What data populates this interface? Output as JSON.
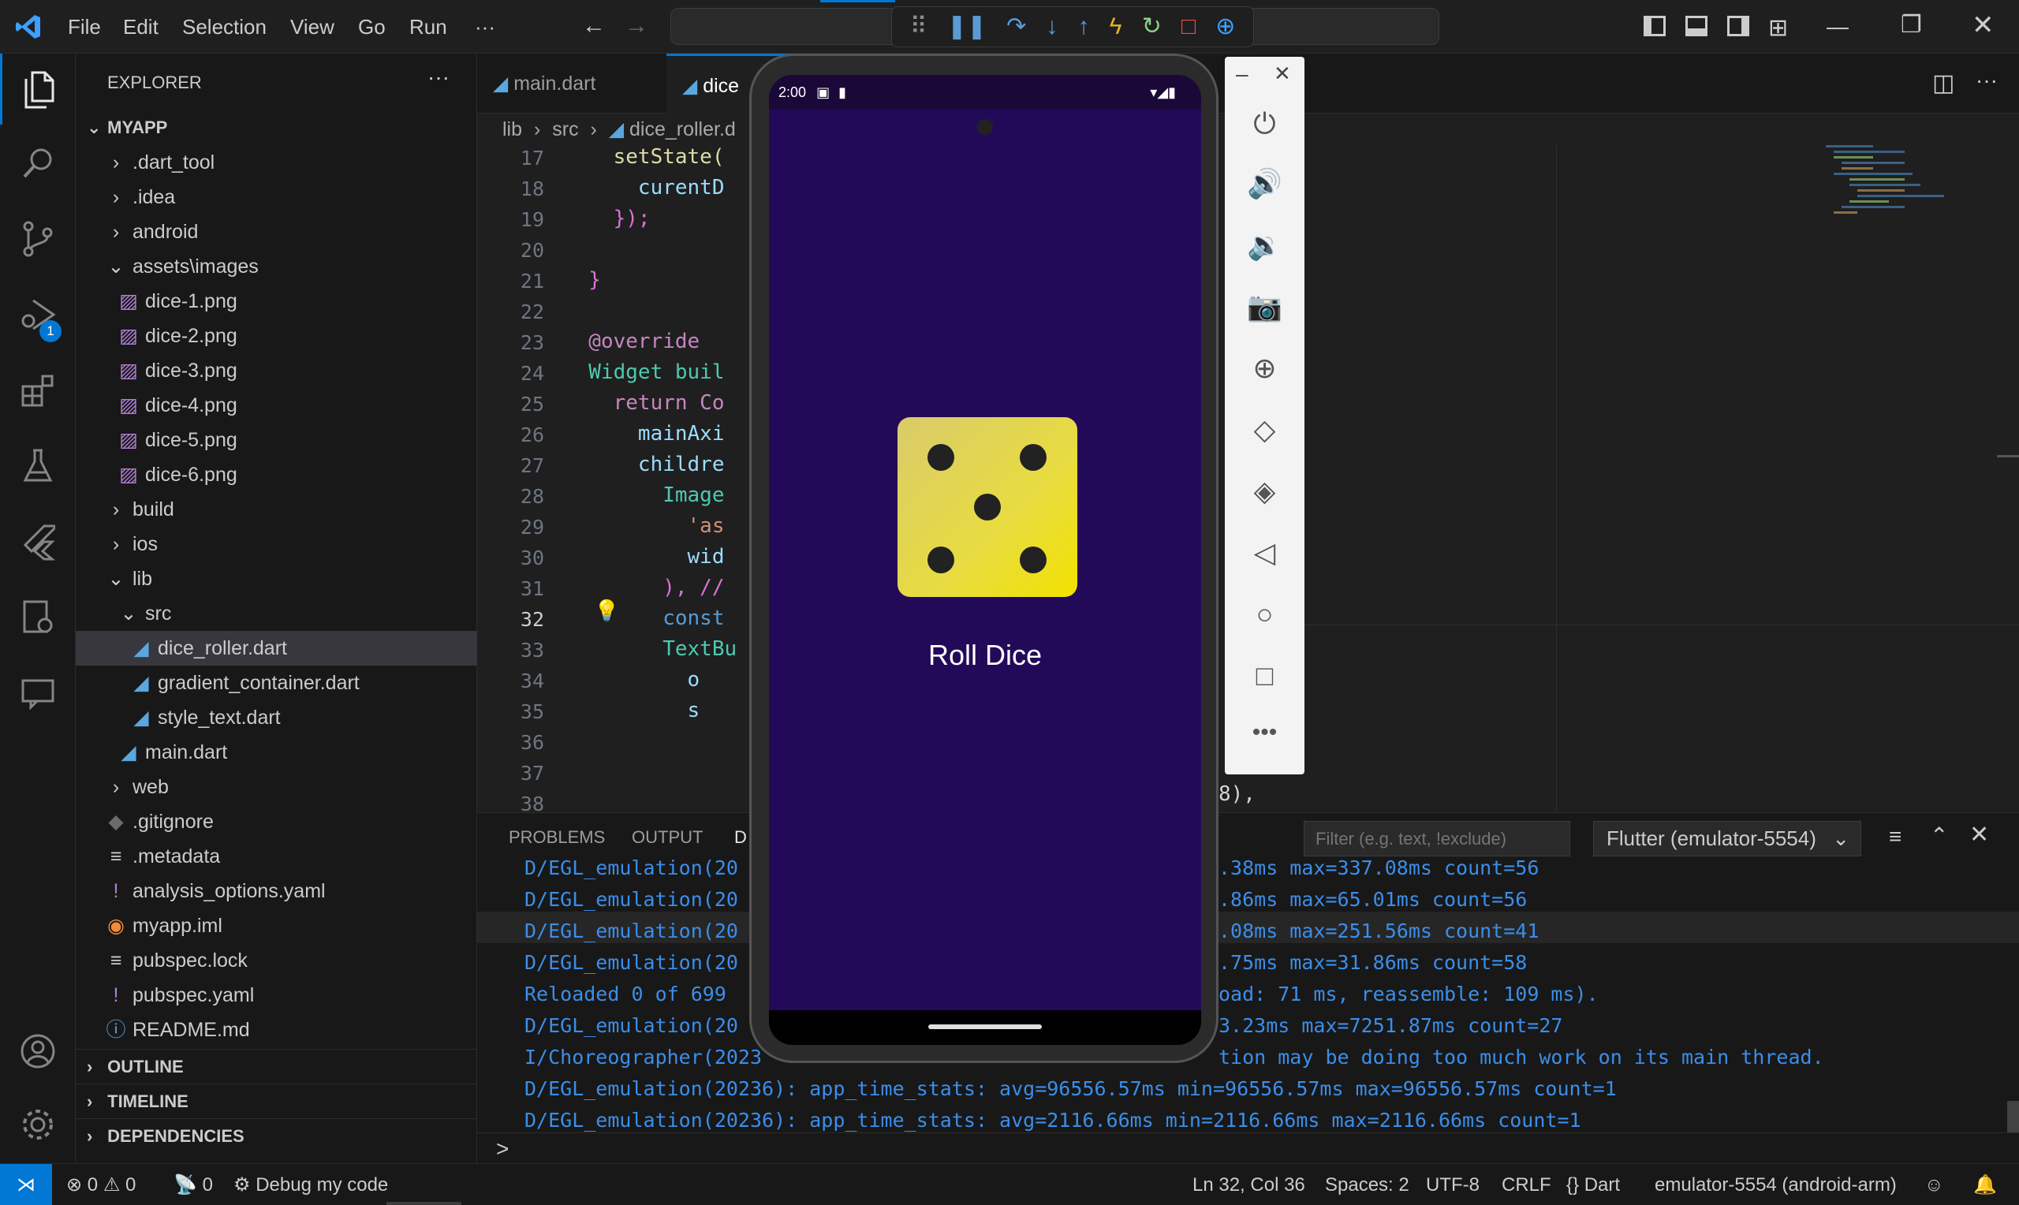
{
  "menu": {
    "file": "File",
    "edit": "Edit",
    "selection": "Selection",
    "view": "View",
    "go": "Go",
    "run": "Run",
    "more": "···"
  },
  "explorer": {
    "title": "EXPLORER",
    "more": "···",
    "root": "MYAPP",
    "tree": [
      {
        "label": ".dart_tool",
        "kind": "folder-closed",
        "indent": 0
      },
      {
        "label": ".idea",
        "kind": "folder-closed",
        "indent": 0
      },
      {
        "label": "android",
        "kind": "folder-closed",
        "indent": 0
      },
      {
        "label": "assets\\images",
        "kind": "folder-open",
        "indent": 0
      },
      {
        "label": "dice-1.png",
        "kind": "image",
        "indent": 1
      },
      {
        "label": "dice-2.png",
        "kind": "image",
        "indent": 1
      },
      {
        "label": "dice-3.png",
        "kind": "image",
        "indent": 1
      },
      {
        "label": "dice-4.png",
        "kind": "image",
        "indent": 1
      },
      {
        "label": "dice-5.png",
        "kind": "image",
        "indent": 1
      },
      {
        "label": "dice-6.png",
        "kind": "image",
        "indent": 1
      },
      {
        "label": "build",
        "kind": "folder-closed",
        "indent": 0
      },
      {
        "label": "ios",
        "kind": "folder-closed",
        "indent": 0
      },
      {
        "label": "lib",
        "kind": "folder-open",
        "indent": 0
      },
      {
        "label": "src",
        "kind": "folder-open",
        "indent": 1
      },
      {
        "label": "dice_roller.dart",
        "kind": "dart",
        "indent": 2,
        "selected": true
      },
      {
        "label": "gradient_container.dart",
        "kind": "dart",
        "indent": 2
      },
      {
        "label": "style_text.dart",
        "kind": "dart",
        "indent": 2
      },
      {
        "label": "main.dart",
        "kind": "dart",
        "indent": 1
      },
      {
        "label": "web",
        "kind": "folder-closed",
        "indent": 0
      },
      {
        "label": ".gitignore",
        "kind": "git",
        "indent": 0
      },
      {
        "label": ".metadata",
        "kind": "lines",
        "indent": 0
      },
      {
        "label": "analysis_options.yaml",
        "kind": "yaml",
        "indent": 0
      },
      {
        "label": "myapp.iml",
        "kind": "rss",
        "indent": 0
      },
      {
        "label": "pubspec.lock",
        "kind": "lines",
        "indent": 0
      },
      {
        "label": "pubspec.yaml",
        "kind": "yaml",
        "indent": 0
      },
      {
        "label": "README.md",
        "kind": "info",
        "indent": 0
      }
    ],
    "outline": "OUTLINE",
    "timeline": "TIMELINE",
    "dependencies": "DEPENDENCIES"
  },
  "tabs": [
    {
      "label": "main.dart"
    },
    {
      "label": "dice"
    }
  ],
  "breadcrumb": {
    "lib": "lib",
    "src": "src",
    "file": "dice_roller.d"
  },
  "editor": {
    "lines": [
      {
        "n": "17",
        "code": "    setState("
      },
      {
        "n": "18",
        "code": "      curentD"
      },
      {
        "n": "19",
        "code": "    });"
      },
      {
        "n": "20",
        "code": ""
      },
      {
        "n": "21",
        "code": "  }"
      },
      {
        "n": "22",
        "code": ""
      },
      {
        "n": "23",
        "code": "  @override"
      },
      {
        "n": "24",
        "code": "  Widget buil"
      },
      {
        "n": "25",
        "code": "    return Co"
      },
      {
        "n": "26",
        "code": "      mainAxi"
      },
      {
        "n": "27",
        "code": "      childre"
      },
      {
        "n": "28",
        "code": "        Image"
      },
      {
        "n": "29",
        "code": "          'as"
      },
      {
        "n": "30",
        "code": "          wid"
      },
      {
        "n": "31",
        "code": "        ), //"
      },
      {
        "n": "32",
        "code": "        const"
      },
      {
        "n": "33",
        "code": "        TextBu"
      },
      {
        "n": "34",
        "code": "          o"
      },
      {
        "n": "35",
        "code": "          s"
      },
      {
        "n": "36",
        "code": ""
      },
      {
        "n": "37",
        "code": ""
      },
      {
        "n": "38",
        "code": ""
      }
    ],
    "tail38": "8),"
  },
  "panel": {
    "problems": "PROBLEMS",
    "output": "OUTPUT",
    "debug": "D",
    "filter_placeholder": "Filter (e.g. text, !exclude)",
    "channel": "Flutter (emulator-5554)",
    "log": [
      {
        "left": "D/EGL_emulation(20",
        "right": ".38ms max=337.08ms count=56",
        "color": "#3b8eea"
      },
      {
        "left": "D/EGL_emulation(20",
        "right": ".86ms max=65.01ms count=56",
        "color": "#3b8eea"
      },
      {
        "left": "D/EGL_emulation(20",
        "right": ".08ms max=251.56ms count=41",
        "color": "#3b8eea"
      },
      {
        "left": "D/EGL_emulation(20",
        "right": ".75ms max=31.86ms count=58",
        "color": "#3b8eea"
      },
      {
        "left": "Reloaded 0 of 699",
        "right": "oad: 71 ms, reassemble: 109 ms).",
        "color": "#3b8eea"
      },
      {
        "left": "D/EGL_emulation(20",
        "right": "3.23ms max=7251.87ms count=27",
        "color": "#3b8eea"
      },
      {
        "left": "I/Choreographer(2023",
        "right": "tion may be doing too much work on its main thread.",
        "color": "#3b8eea"
      },
      {
        "left": "D/EGL_emulation(20236): app_time_stats: avg=96556.57ms min=96556.57ms max=96556.57ms count=1",
        "right": "",
        "color": "#3b8eea"
      },
      {
        "left": "D/EGL_emulation(20236): app_time_stats: avg=2116.66ms min=2116.66ms max=2116.66ms count=1",
        "right": "",
        "color": "#3b8eea"
      }
    ],
    "prompt": ">"
  },
  "status": {
    "errors": "0",
    "warnings": "0",
    "ports": "0",
    "debug": "Debug my code",
    "position": "Ln 32, Col 36",
    "spaces": "Spaces: 2",
    "encoding": "UTF-8",
    "eol": "CRLF",
    "lang_icon": "{}",
    "language": "Dart",
    "device": "emulator-5554 (android-arm)"
  },
  "phone": {
    "time": "2:00",
    "button": "Roll Dice",
    "dice_value": 5
  },
  "colors": {
    "accent": "#0078d4",
    "app_bg": "#230a59",
    "dice": "#e8da4a"
  }
}
